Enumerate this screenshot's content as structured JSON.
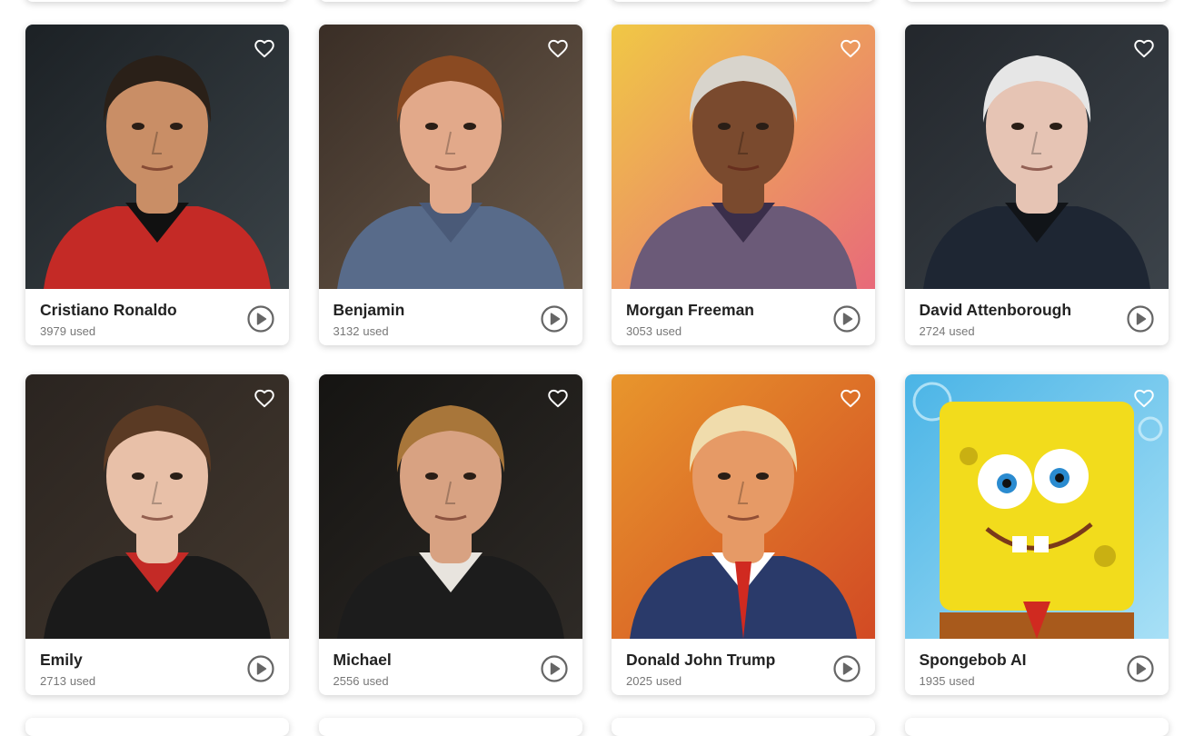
{
  "usage_suffix": "used",
  "cards": [
    {
      "name": "Cristiano Ronaldo",
      "uses": "3979",
      "bg": [
        "#1c2125",
        "#3a4247"
      ],
      "skin": "#c98e66",
      "hair": "#2a2018",
      "shirt": "#c42a26",
      "collar": "#111111"
    },
    {
      "name": "Benjamin",
      "uses": "3132",
      "bg": [
        "#3a2e26",
        "#6b5a4a"
      ],
      "skin": "#e2a98a",
      "hair": "#8a4a22",
      "shirt": "#586b8a",
      "collar": "#4a5a78"
    },
    {
      "name": "Morgan Freeman",
      "uses": "3053",
      "bg": [
        "#f0c845",
        "#e86a7a"
      ],
      "skin": "#7a4a2e",
      "hair": "#d8d4cc",
      "shirt": "#6b5a78",
      "collar": "#3a2e4a"
    },
    {
      "name": "David Attenborough",
      "uses": "2724",
      "bg": [
        "#23272c",
        "#3c434a"
      ],
      "skin": "#e6c4b4",
      "hair": "#e6e6e6",
      "shirt": "#1e2633",
      "collar": "#111418"
    },
    {
      "name": "Emily",
      "uses": "2713",
      "bg": [
        "#2a2420",
        "#43382e"
      ],
      "skin": "#e8c0a8",
      "hair": "#5a3a24",
      "shirt": "#1a1a1a",
      "collar": "#c42a26"
    },
    {
      "name": "Michael",
      "uses": "2556",
      "bg": [
        "#151412",
        "#2e2a26"
      ],
      "skin": "#d8a282",
      "hair": "#a8763a",
      "shirt": "#1c1c1c",
      "collar": "#e8e4de"
    },
    {
      "name": "Donald John Trump",
      "uses": "2025",
      "bg": [
        "#e8962c",
        "#d24a24"
      ],
      "skin": "#e69a66",
      "hair": "#f0dcac",
      "shirt": "#2a3a6a",
      "collar": "#ffffff"
    },
    {
      "name": "Spongebob AI",
      "uses": "1935",
      "bg": [
        "#4ab4e6",
        "#a8e0f6"
      ],
      "skin": "#f2dc1c",
      "hair": "#f2dc1c",
      "shirt": "#a85a1c",
      "collar": "#ffffff"
    }
  ]
}
